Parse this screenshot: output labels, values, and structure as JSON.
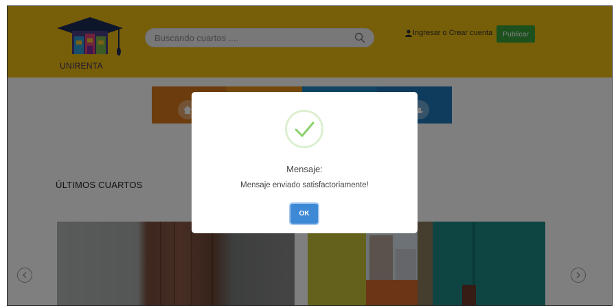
{
  "header": {
    "logo_text": "UNIRENTA",
    "search_placeholder": "Buscando cuartos ....",
    "login_text": "Ingresar o Crear cuenta",
    "publish_label": "Publicar",
    "bg_color": "#efbd10"
  },
  "categories": {
    "tiles": [
      {
        "icon": "home-icon",
        "color": "#d9781a"
      },
      {
        "icon": "category-icon",
        "color": "#e6901a"
      },
      {
        "icon": "category-icon",
        "color": "#1a86c7"
      },
      {
        "icon": "ship-icon",
        "color": "#1e77ba"
      }
    ]
  },
  "main": {
    "section_title": "ÚLTIMOS CUARTOS"
  },
  "modal": {
    "title": "Mensaje:",
    "message": "Mensaje enviado satisfactoriamente!",
    "ok_label": "OK",
    "icon": "check-icon",
    "accent": "#3d89d6"
  }
}
